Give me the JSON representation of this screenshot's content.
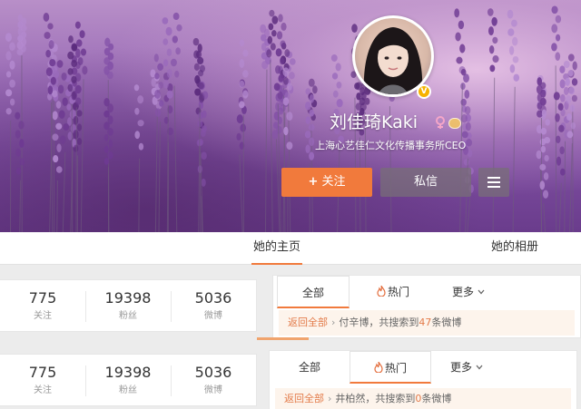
{
  "profile": {
    "name": "刘佳琦Kaki",
    "bio": "上海心艺佳仁文化传播事务所CEO",
    "verified_badge": "V",
    "gender_icon": "female-icon",
    "level_icon": "level-icon"
  },
  "actions": {
    "follow_plus": "+",
    "follow_label": "关注",
    "message_label": "私信",
    "more_icon": "menu-icon"
  },
  "tabs": {
    "home": "她的主页",
    "album": "她的相册"
  },
  "stats_panels": [
    {
      "following": {
        "value": "775",
        "label": "关注"
      },
      "followers": {
        "value": "19398",
        "label": "粉丝"
      },
      "posts": {
        "value": "5036",
        "label": "微博"
      }
    },
    {
      "following": {
        "value": "775",
        "label": "关注"
      },
      "followers": {
        "value": "19398",
        "label": "粉丝"
      },
      "posts": {
        "value": "5036",
        "label": "微博"
      }
    }
  ],
  "filter_panels": [
    {
      "tabs": {
        "all": "全部",
        "hot": "热门",
        "more": "更多"
      },
      "active": "all",
      "back": "返回全部",
      "sep": "›",
      "query_prefix": "付辛博，共搜索到",
      "count": "47",
      "suffix": "条微博"
    },
    {
      "tabs": {
        "all": "全部",
        "hot": "热门",
        "more": "更多"
      },
      "active": "hot",
      "back": "返回全部",
      "sep": "›",
      "query_prefix": "井柏然，共搜索到",
      "count": "0",
      "suffix": "条微博"
    }
  ],
  "colors": {
    "accent": "#f17a3c",
    "link": "#e37b4a",
    "badge": "#f6b300"
  }
}
